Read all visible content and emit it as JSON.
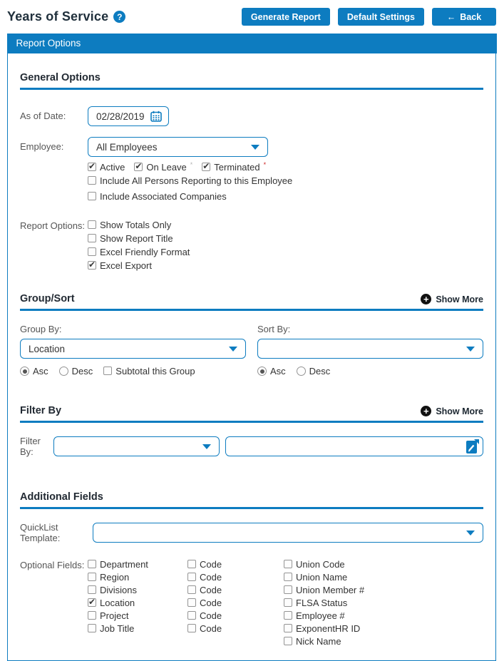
{
  "colors": {
    "accent": "#0d7cc0",
    "required_red": "#cc1f1f",
    "title_text": "#20303c"
  },
  "icons": {
    "help_glyph": "?",
    "back_arrow": "←",
    "plus_glyph": "+"
  },
  "header": {
    "title": "Years of Service",
    "buttons": {
      "generate": "Generate Report",
      "defaults": "Default Settings",
      "back_label": "Back"
    }
  },
  "panel_title": "Report Options",
  "general": {
    "heading": "General Options",
    "as_of_date": {
      "label": "As of Date:",
      "value": "02/28/2019"
    },
    "employee": {
      "label": "Employee:",
      "value": "All Employees"
    },
    "status": [
      {
        "label": "Active",
        "checked": true,
        "sup": ""
      },
      {
        "label": "On Leave",
        "checked": true,
        "sup": "*"
      },
      {
        "label": "Terminated",
        "checked": true,
        "sup": "*"
      }
    ],
    "include_reporting": {
      "label": "Include All Persons Reporting to this Employee",
      "checked": false
    },
    "include_companies": {
      "label": "Include Associated Companies",
      "checked": false
    },
    "report_options": {
      "label": "Report Options:",
      "items": [
        {
          "label": "Show Totals Only",
          "checked": false
        },
        {
          "label": "Show Report Title",
          "checked": false
        },
        {
          "label": "Excel Friendly Format",
          "checked": false
        },
        {
          "label": "Excel Export",
          "checked": true
        }
      ]
    }
  },
  "group_sort": {
    "heading": "Group/Sort",
    "show_more": "Show More",
    "group_by": {
      "label": "Group By:",
      "value": "Location",
      "asc": "Asc",
      "desc": "Desc",
      "asc_selected": true,
      "desc_selected": false,
      "subtotal_label": "Subtotal this Group",
      "subtotal_checked": false
    },
    "sort_by": {
      "label": "Sort By:",
      "value": "",
      "asc": "Asc",
      "desc": "Desc",
      "asc_selected": true,
      "desc_selected": false
    }
  },
  "filter": {
    "heading": "Filter By",
    "show_more": "Show More",
    "label": "Filter By:",
    "dropdown_value": "",
    "value_input": ""
  },
  "additional": {
    "heading": "Additional Fields",
    "quicklist": {
      "label": "QuickList Template:",
      "value": ""
    },
    "optional_label": "Optional Fields:",
    "col1": [
      {
        "label": "Department",
        "checked": false
      },
      {
        "label": "Region",
        "checked": false
      },
      {
        "label": "Divisions",
        "checked": false
      },
      {
        "label": "Location",
        "checked": true
      },
      {
        "label": "Project",
        "checked": false
      },
      {
        "label": "Job Title",
        "checked": false
      }
    ],
    "col2": [
      {
        "label": "Code",
        "checked": false
      },
      {
        "label": "Code",
        "checked": false
      },
      {
        "label": "Code",
        "checked": false
      },
      {
        "label": "Code",
        "checked": false
      },
      {
        "label": "Code",
        "checked": false
      },
      {
        "label": "Code",
        "checked": false
      }
    ],
    "col3": [
      {
        "label": "Union Code",
        "checked": false
      },
      {
        "label": "Union Name",
        "checked": false
      },
      {
        "label": "Union Member #",
        "checked": false
      },
      {
        "label": "FLSA Status",
        "checked": false
      },
      {
        "label": "Employee #",
        "checked": false
      },
      {
        "label": "ExponentHR ID",
        "checked": false
      },
      {
        "label": "Nick Name",
        "checked": false
      }
    ]
  }
}
